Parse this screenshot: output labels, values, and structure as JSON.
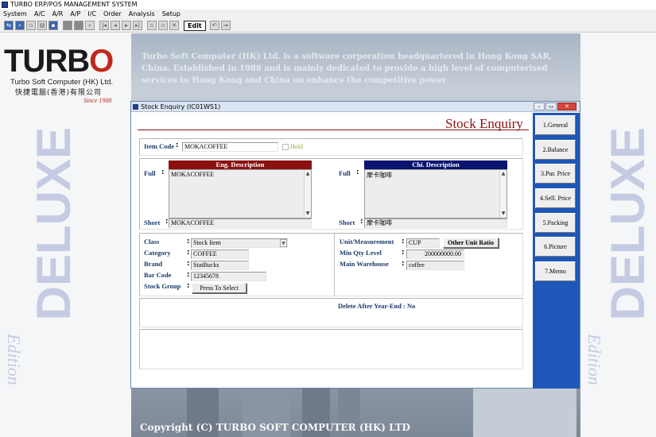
{
  "app": {
    "title": "TURBO ERP/POS MANAGEMENT SYSTEM"
  },
  "menu": [
    "System",
    "A/C",
    "A/R",
    "A/P",
    "I/C",
    "Order",
    "Analysis",
    "Setup"
  ],
  "toolbar": {
    "edit_label": "Edit"
  },
  "background": {
    "intro_text": "Turbo Soft Computer (HK) Ltd. is a software corporation headquartered in Hong Kong SAR, China. Established in 1988 and is mainly dedicated to provide a high level of computerised services to Hong Kong and China on enhance the competitive power",
    "copyright": "Copyright (C) TURBO SOFT COMPUTER (HK) LTD",
    "logo_text": "TURBO",
    "logo_company": "Turbo Soft Computer (HK) Ltd.",
    "logo_chinese": "快捷電腦(香港)有限公司",
    "logo_since": "Since 1988",
    "side_word": "DELUXE",
    "side_edition": "Edition"
  },
  "window": {
    "title": "Stock Enquiry (IC01WS1)",
    "form_title": "Stock Enquiry"
  },
  "tabs": [
    "1.General",
    "2.Balance",
    "3.Pur. Price",
    "4.Sell. Price",
    "5.Packing",
    "6.Picture",
    "7.Memo"
  ],
  "item": {
    "code_label": "Item Code",
    "code_value": "MOKACOFFEE",
    "hold_label": "Hold"
  },
  "description": {
    "eng_header": "Eng. Description",
    "chi_header": "Chi. Description",
    "full_label": "Full",
    "short_label": "Short",
    "eng_full": "MOKACOFFEE",
    "eng_short": "MOKACOFFEE",
    "chi_full": "摩卡咖啡",
    "chi_short": "摩卡咖啡"
  },
  "details": {
    "class_label": "Class",
    "class_value": "Stock Item",
    "category_label": "Category",
    "category_value": "COFFEE",
    "brand_label": "Brand",
    "brand_value": "StatBucks",
    "barcode_label": "Bar Code",
    "barcode_value": "12345678",
    "stockgroup_label": "Stock Group",
    "stockgroup_button": "Press To Select",
    "unit_label": "Unit/Measurement",
    "unit_value": "CUP",
    "other_unit_button": "Other Unit Ratio",
    "minqty_label": "Min Qty Level",
    "minqty_value": "200000000.00",
    "warehouse_label": "Main Warehouse",
    "warehouse_value": "coffee",
    "delete_label": "Delete After Year-End :",
    "delete_value": "No"
  }
}
